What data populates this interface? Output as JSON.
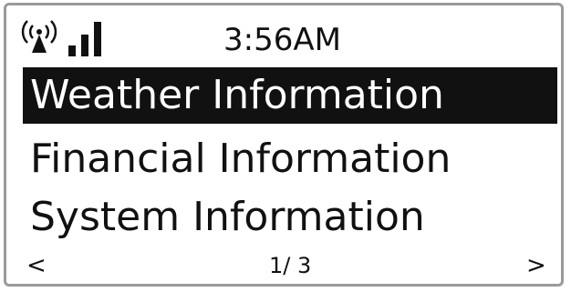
{
  "status": {
    "time": "3:56AM",
    "antenna_icon": "antenna-icon",
    "signal_icon": "signal-strength-icon",
    "signal_bars": 3
  },
  "menu": {
    "items": [
      {
        "label": "Weather Information",
        "selected": true
      },
      {
        "label": "Financial Information",
        "selected": false
      },
      {
        "label": "System Information",
        "selected": false
      }
    ]
  },
  "footer": {
    "prev": "<",
    "page": "1/ 3",
    "next": ">"
  },
  "colors": {
    "foreground": "#111111",
    "background": "#ffffff",
    "highlight_bg": "#111111",
    "highlight_fg": "#ffffff"
  }
}
